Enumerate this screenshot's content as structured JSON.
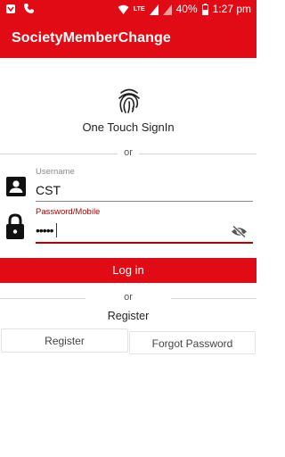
{
  "status_bar": {
    "network_label": "LTE",
    "battery": "40%",
    "time": "1:27 pm"
  },
  "app_bar": {
    "title": "SocietyMemberChange"
  },
  "touch": {
    "label": "One Touch SignIn"
  },
  "divider_1": {
    "label": "or"
  },
  "username": {
    "label": "Username",
    "value": "CST"
  },
  "password": {
    "label": "Password/Mobile",
    "masked_value": "•••••"
  },
  "login": {
    "label": "Log in"
  },
  "divider_2": {
    "label": "or"
  },
  "register_heading": "Register",
  "buttons": {
    "register": "Register",
    "forgot": "Forgot Password"
  },
  "colors": {
    "primary": "#e00b14",
    "field_underline_active": "#b00000"
  }
}
